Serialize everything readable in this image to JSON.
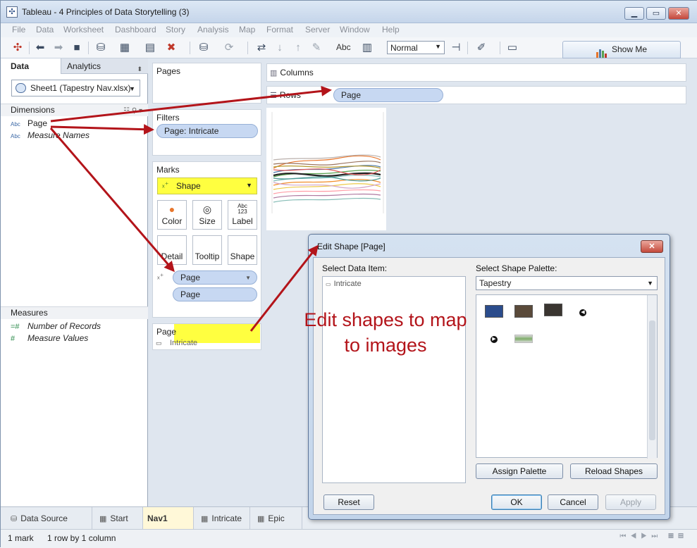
{
  "window": {
    "title": "Tableau - 4 Principles of Data Storytelling (3)"
  },
  "menu": [
    "File",
    "Data",
    "Worksheet",
    "Dashboard",
    "Story",
    "Analysis",
    "Map",
    "Format",
    "Server",
    "Window",
    "Help"
  ],
  "toolbar": {
    "abc_label": "Abc",
    "fit_select": "Normal",
    "show_me": "Show Me"
  },
  "left_pane": {
    "tabs": [
      "Data",
      "Analytics"
    ],
    "datasource": "Sheet1 (Tapestry Nav.xlsx)",
    "dimensions_header": "Dimensions",
    "dimensions": [
      {
        "type": "Abc",
        "name": "Page"
      },
      {
        "type": "Abc",
        "name": "Measure Names"
      }
    ],
    "measures_header": "Measures",
    "measures": [
      {
        "type": "=#",
        "name": "Number of Records"
      },
      {
        "type": "#",
        "name": "Measure Values"
      }
    ]
  },
  "shelves": {
    "pages_title": "Pages",
    "filters_title": "Filters",
    "filter_pill": "Page: Intricate",
    "marks_title": "Marks",
    "mark_type": "Shape",
    "mark_buttons": [
      {
        "icon": "color-icon",
        "label": "Color"
      },
      {
        "icon": "size-icon",
        "label": "Size"
      },
      {
        "icon": "label-icon",
        "label": "Label",
        "glyph": "Abc\n123"
      },
      {
        "icon": "detail-icon",
        "label": "Detail"
      },
      {
        "icon": "tooltip-icon",
        "label": "Tooltip"
      },
      {
        "icon": "shape-icon",
        "label": "Shape"
      }
    ],
    "mark_pills": [
      "Page",
      "Page"
    ],
    "legend_title": "Page",
    "legend_item": "Intricate"
  },
  "canvas": {
    "columns_label": "Columns",
    "rows_label": "Rows",
    "rows_pill": "Page"
  },
  "dialog": {
    "title": "Edit Shape [Page]",
    "select_data_item_label": "Select Data Item:",
    "data_items": [
      "Intricate"
    ],
    "select_palette_label": "Select Shape Palette:",
    "palette": "Tapestry",
    "buttons": {
      "assign": "Assign Palette",
      "reload": "Reload Shapes",
      "reset": "Reset",
      "ok": "OK",
      "cancel": "Cancel",
      "apply": "Apply"
    }
  },
  "callout": {
    "line1": "Edit shapes to map",
    "line2": "to images"
  },
  "sheet_tabs": [
    {
      "label": "Data Source",
      "icon": "database-icon"
    },
    {
      "label": "Start",
      "icon": "grid-icon"
    },
    {
      "label": "Nav1",
      "icon": "",
      "active": true
    },
    {
      "label": "Intricate",
      "icon": "grid-icon"
    },
    {
      "label": "Epic",
      "icon": "grid-icon"
    }
  ],
  "status": {
    "marks": "1 mark",
    "rows_cols": "1 row by 1 column"
  },
  "colors": {
    "annotation_red": "#b3141a",
    "highlight_yellow": "#ffff40",
    "pill_blue": "#c7d8f2"
  }
}
